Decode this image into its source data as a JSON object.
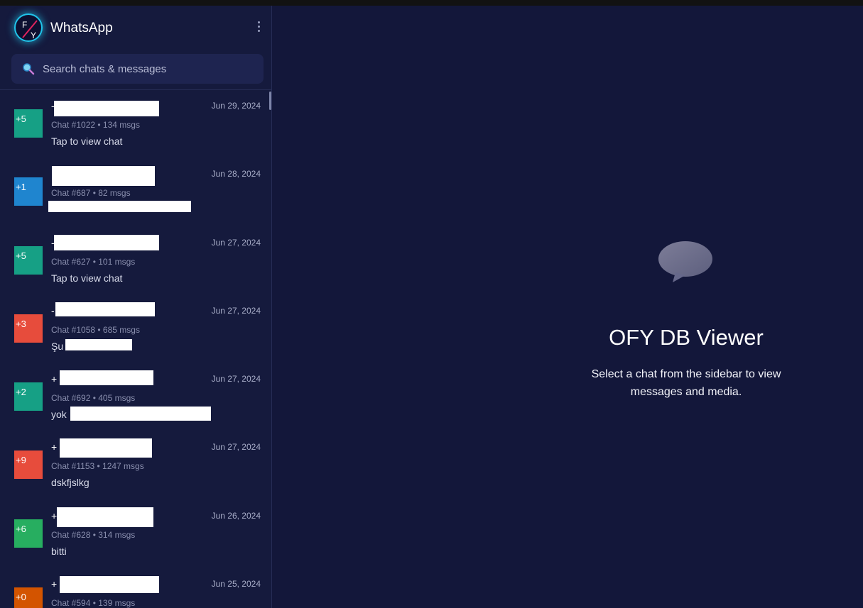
{
  "app": {
    "title": "WhatsApp",
    "logo_text": "FY"
  },
  "search": {
    "placeholder": "Search chats & messages"
  },
  "chats": [
    {
      "badge": "+5",
      "color": "#16a085",
      "date": "Jun 29, 2024",
      "meta": "Chat #1022 • 134 msgs",
      "preview": "Tap to view chat"
    },
    {
      "badge": "+1",
      "color": "#1f85cf",
      "date": "Jun 28, 2024",
      "meta": "Chat #687 • 82 msgs",
      "preview": ""
    },
    {
      "badge": "+5",
      "color": "#16a085",
      "date": "Jun 27, 2024",
      "meta": "Chat #627 • 101 msgs",
      "preview": "Tap to view chat"
    },
    {
      "badge": "+3",
      "color": "#e74c3c",
      "date": "Jun 27, 2024",
      "meta": "Chat #1058 • 685 msgs",
      "preview": "Şu"
    },
    {
      "badge": "+2",
      "color": "#16a085",
      "date": "Jun 27, 2024",
      "meta": "Chat #692 • 405 msgs",
      "preview": "yok"
    },
    {
      "badge": "+9",
      "color": "#e74c3c",
      "date": "Jun 27, 2024",
      "meta": "Chat #1153 • 1247 msgs",
      "preview": "dskfjslkg"
    },
    {
      "badge": "+6",
      "color": "#27ae60",
      "date": "Jun 26, 2024",
      "meta": "Chat #628 • 314 msgs",
      "preview": "bitti"
    },
    {
      "badge": "+0",
      "color": "#d35400",
      "date": "Jun 25, 2024",
      "meta": "Chat #594 • 139 msgs",
      "preview": ""
    }
  ],
  "main": {
    "title": "OFY DB Viewer",
    "subtitle": "Select a chat from the sidebar to view messages and media."
  }
}
